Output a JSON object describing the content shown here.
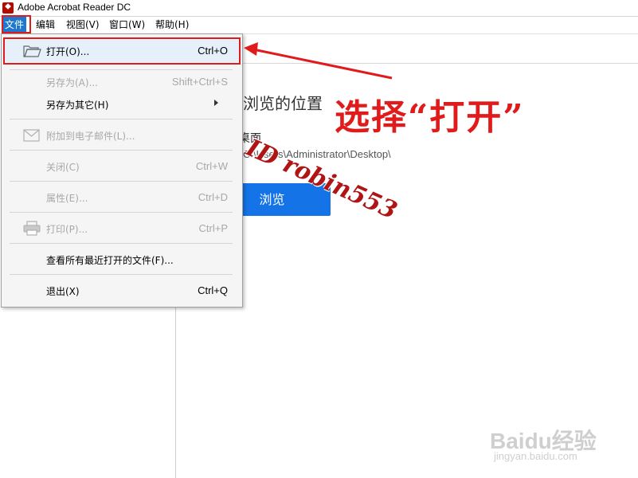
{
  "window": {
    "title": "Adobe Acrobat Reader DC",
    "app_icon": "acrobat-icon"
  },
  "menubar": {
    "items": [
      {
        "label": "文件",
        "active": true
      },
      {
        "label": "编辑"
      },
      {
        "label": "视图(V)"
      },
      {
        "label": "窗口(W)"
      },
      {
        "label": "帮助(H)"
      }
    ]
  },
  "file_menu": {
    "items": [
      {
        "label": "打开(O)...",
        "shortcut": "Ctrl+O",
        "icon": "folder-open-icon",
        "enabled": true,
        "selected": true
      },
      {
        "label": "另存为(A)...",
        "shortcut": "Shift+Ctrl+S",
        "enabled": false
      },
      {
        "label": "另存为其它(H)",
        "shortcut": "",
        "enabled": true,
        "submenu": true
      },
      {
        "label": "附加到电子邮件(L)...",
        "shortcut": "",
        "icon": "email-icon",
        "enabled": false
      },
      {
        "label": "关闭(C)",
        "shortcut": "Ctrl+W",
        "enabled": false
      },
      {
        "label": "属性(E)...",
        "shortcut": "Ctrl+D",
        "enabled": false
      },
      {
        "label": "打印(P)...",
        "shortcut": "Ctrl+P",
        "icon": "printer-icon",
        "enabled": false
      },
      {
        "label": "查看所有最近打开的文件(F)...",
        "shortcut": "",
        "enabled": true
      },
      {
        "label": "退出(X)",
        "shortcut": "Ctrl+Q",
        "enabled": true
      }
    ]
  },
  "content": {
    "heading": "浏览的位置",
    "desktop_label": "桌面",
    "desktop_path": "C:\\Users\\Administrator\\Desktop\\",
    "browse_button": "浏览"
  },
  "annotation": {
    "text": "选择“打开”",
    "color": "#e01b1b"
  },
  "watermark": {
    "text": "ID robin553"
  },
  "branding": {
    "logo": "Baidu经验",
    "url": "jingyan.baidu.com"
  },
  "colors": {
    "accent": "#1473e6",
    "menu_active": "#1e78d0",
    "annotation_red": "#e01b1b"
  }
}
